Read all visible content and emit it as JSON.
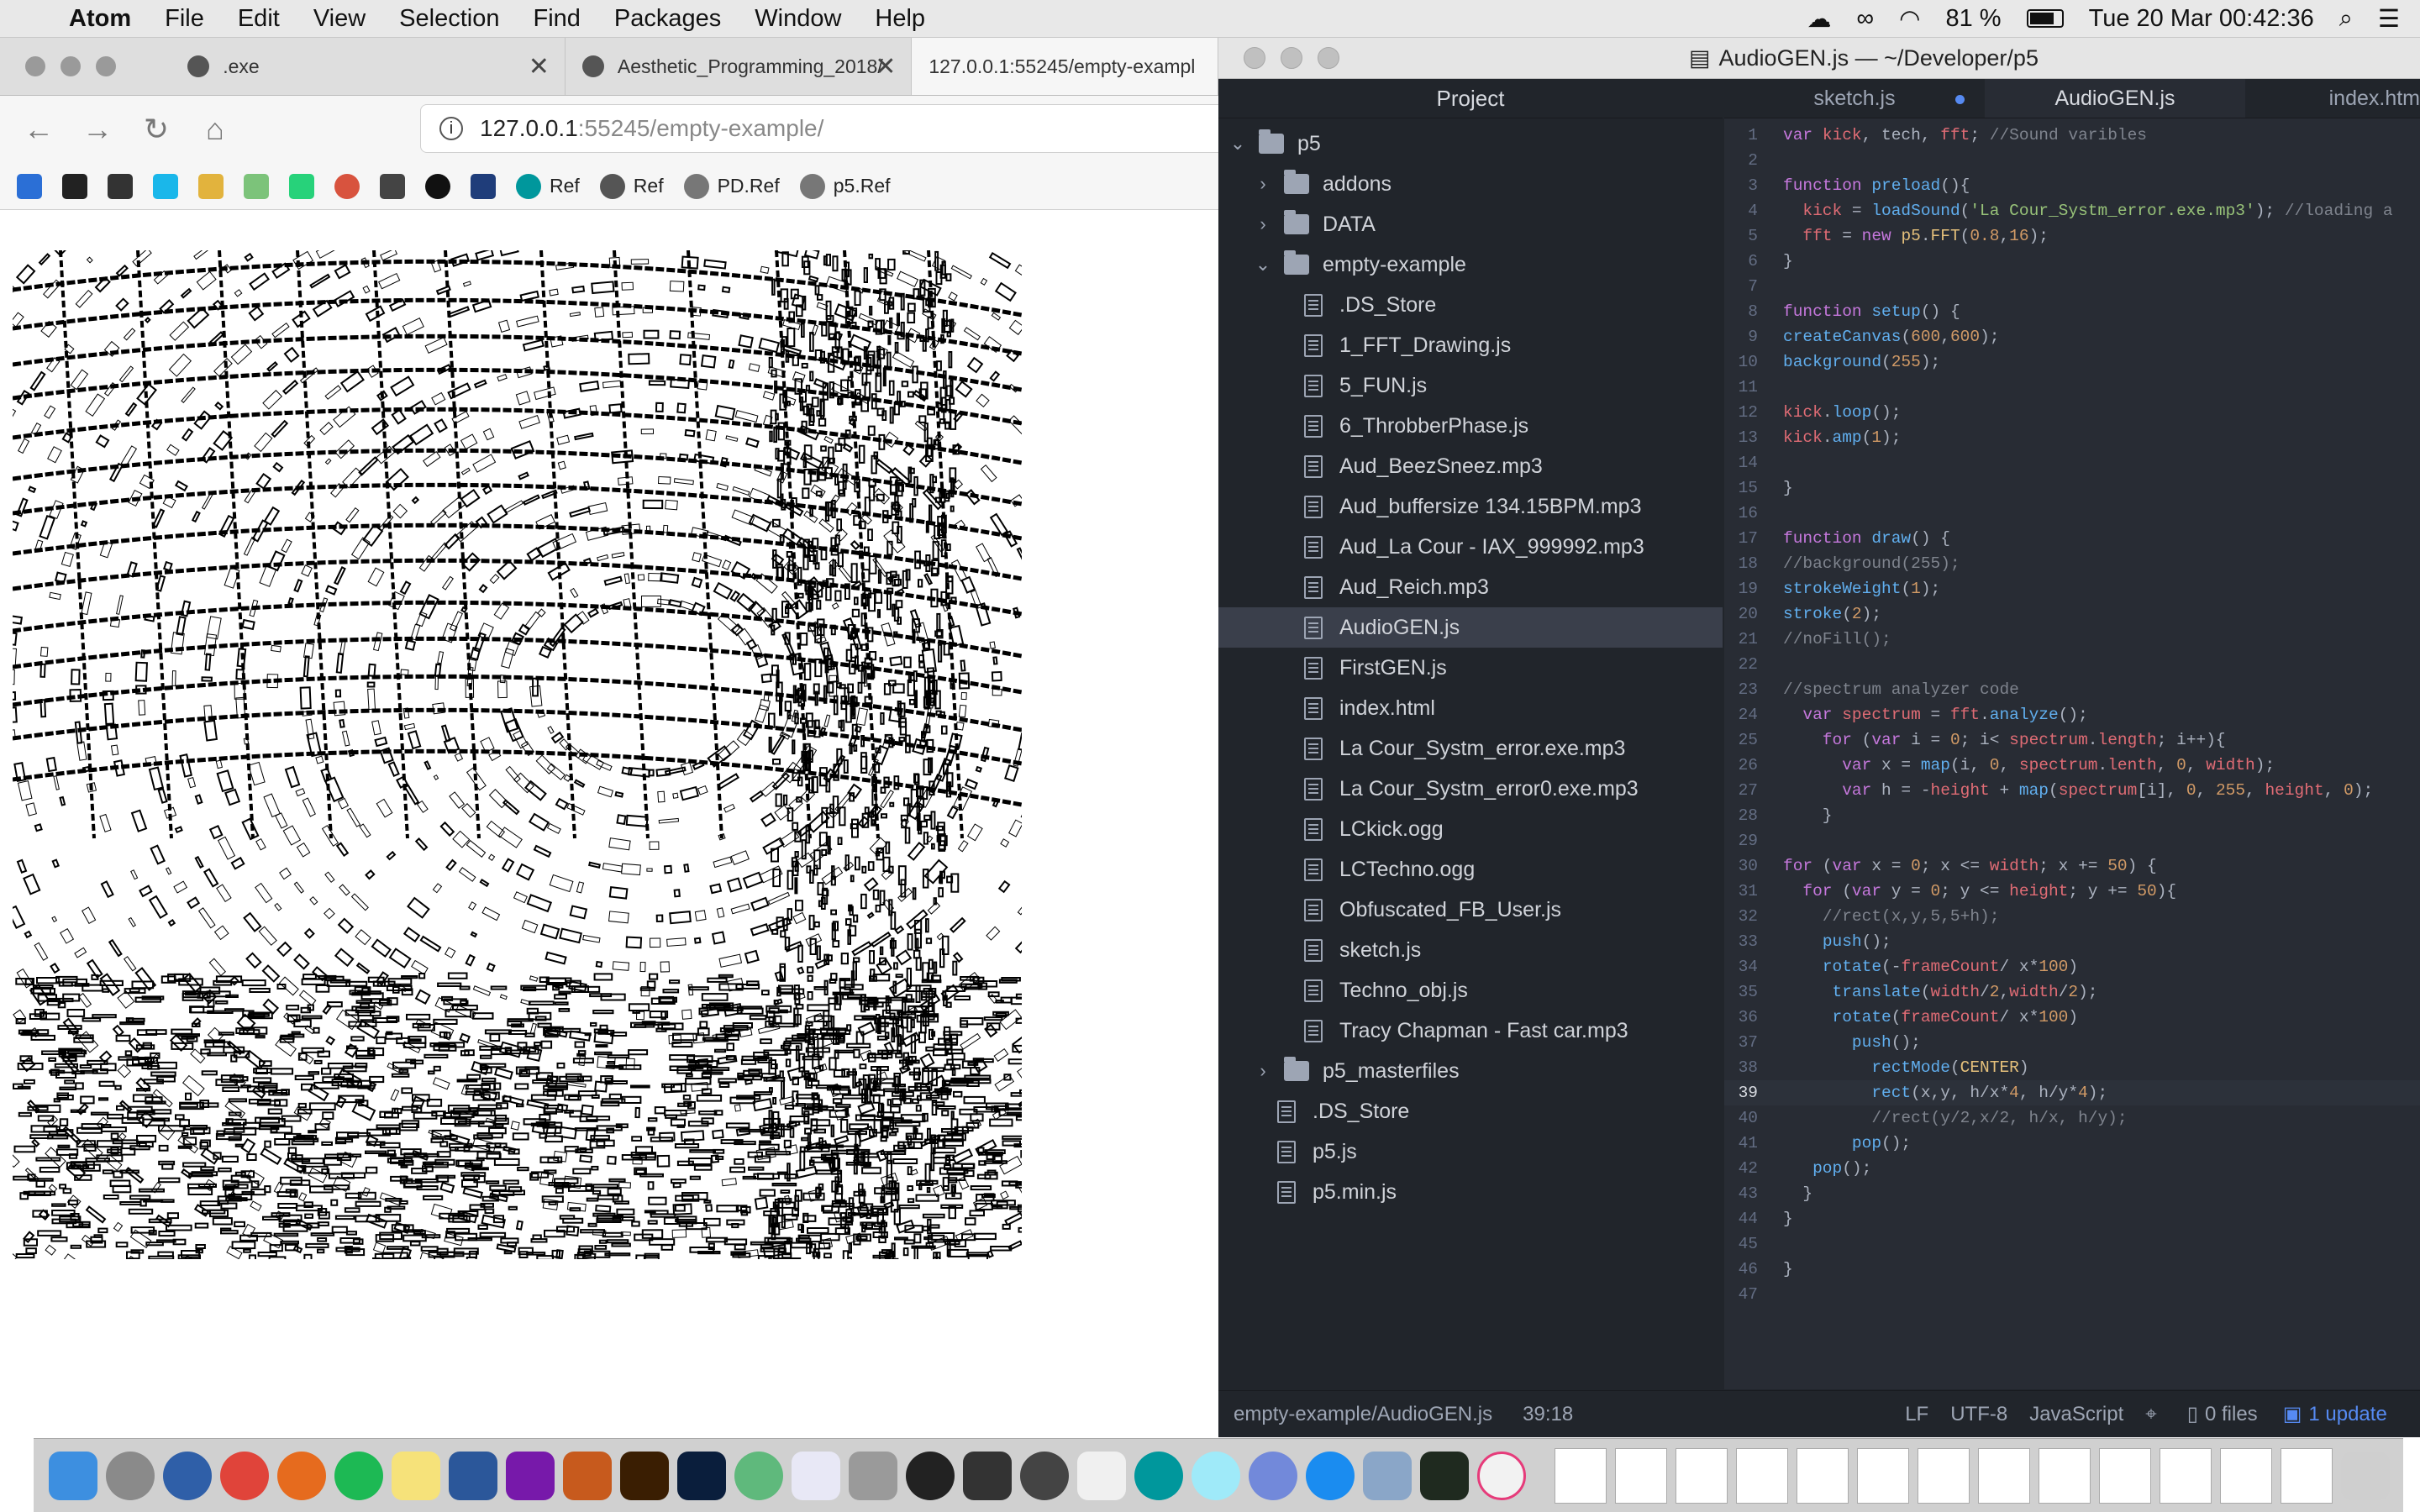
{
  "menubar": {
    "app_name": "Atom",
    "items": [
      "File",
      "Edit",
      "View",
      "Selection",
      "Find",
      "Packages",
      "Window",
      "Help"
    ],
    "battery": "81 %",
    "clock": "Tue 20 Mar  00:42:36"
  },
  "browser": {
    "tabs": [
      {
        "title": ".exe"
      },
      {
        "title": "Aesthetic_Programming_2018/"
      },
      {
        "title": "127.0.0.1:55245/empty-exampl"
      }
    ],
    "url_host": "127.0.0.1",
    "url_port_path": ":55245/empty-example/",
    "bookmarks": [
      "Ref",
      "Ref",
      "PD.Ref",
      "p5.Ref"
    ]
  },
  "atom": {
    "window_title": "AudioGEN.js — ~/Developer/p5",
    "project_header": "Project",
    "tabs": [
      "sketch.js",
      "AudioGEN.js",
      "index.htm"
    ],
    "tree": [
      {
        "label": "p5",
        "type": "folder",
        "depth": 0,
        "open": true
      },
      {
        "label": "addons",
        "type": "folder",
        "depth": 1,
        "open": false
      },
      {
        "label": "DATA",
        "type": "folder",
        "depth": 1,
        "open": false
      },
      {
        "label": "empty-example",
        "type": "folder",
        "depth": 1,
        "open": true
      },
      {
        "label": ".DS_Store",
        "type": "file",
        "depth": 2
      },
      {
        "label": "1_FFT_Drawing.js",
        "type": "file",
        "depth": 2
      },
      {
        "label": "5_FUN.js",
        "type": "file",
        "depth": 2
      },
      {
        "label": "6_ThrobberPhase.js",
        "type": "file",
        "depth": 2
      },
      {
        "label": "Aud_BeezSneez.mp3",
        "type": "file",
        "depth": 2
      },
      {
        "label": "Aud_buffersize 134.15BPM.mp3",
        "type": "file",
        "depth": 2
      },
      {
        "label": "Aud_La Cour - IAX_999992.mp3",
        "type": "file",
        "depth": 2
      },
      {
        "label": "Aud_Reich.mp3",
        "type": "file",
        "depth": 2
      },
      {
        "label": "AudioGEN.js",
        "type": "file",
        "depth": 2,
        "selected": true
      },
      {
        "label": "FirstGEN.js",
        "type": "file",
        "depth": 2
      },
      {
        "label": "index.html",
        "type": "file",
        "depth": 2
      },
      {
        "label": "La Cour_Systm_error.exe.mp3",
        "type": "file",
        "depth": 2
      },
      {
        "label": "La Cour_Systm_error0.exe.mp3",
        "type": "file",
        "depth": 2
      },
      {
        "label": "LCkick.ogg",
        "type": "file",
        "depth": 2
      },
      {
        "label": "LCTechno.ogg",
        "type": "file",
        "depth": 2
      },
      {
        "label": "Obfuscated_FB_User.js",
        "type": "file",
        "depth": 2
      },
      {
        "label": "sketch.js",
        "type": "file",
        "depth": 2
      },
      {
        "label": "Techno_obj.js",
        "type": "file",
        "depth": 2
      },
      {
        "label": "Tracy Chapman - Fast car.mp3",
        "type": "file",
        "depth": 2
      },
      {
        "label": "p5_masterfiles",
        "type": "folder",
        "depth": 1,
        "open": false
      },
      {
        "label": ".DS_Store",
        "type": "file",
        "depth": 1
      },
      {
        "label": "p5.js",
        "type": "file",
        "depth": 1
      },
      {
        "label": "p5.min.js",
        "type": "file",
        "depth": 1
      }
    ],
    "code": [
      "var kick, tech, fft; //Sound varibles",
      "",
      "function preload(){",
      "  kick = loadSound('La Cour_Systm_error.exe.mp3'); //loading a",
      "  fft = new p5.FFT(0.8,16);",
      "}",
      "",
      "function setup() {",
      "createCanvas(600,600);",
      "background(255);",
      "",
      "kick.loop();",
      "kick.amp(1);",
      "",
      "}",
      "",
      "function draw() {",
      "//background(255);",
      "strokeWeight(1);",
      "stroke(2);",
      "//noFill();",
      "",
      "//spectrum analyzer code",
      "  var spectrum = fft.analyze();",
      "    for (var i = 0; i< spectrum.length; i++){",
      "      var x = map(i, 0, spectrum.lenth, 0, width);",
      "      var h = -height + map(spectrum[i], 0, 255, height, 0);",
      "    }",
      "",
      "for (var x = 0; x <= width; x += 50) {",
      "  for (var y = 0; y <= height; y += 50){",
      "    //rect(x,y,5,5+h);",
      "    push();",
      "    rotate(-frameCount/ x*100)",
      "     translate(width/2,width/2);",
      "     rotate(frameCount/ x*100)",
      "       push();",
      "         rectMode(CENTER)",
      "         rect(x,y, h/x*4, h/y*4);",
      "         //rect(y/2,x/2, h/x, h/y);",
      "       pop();",
      "   pop();",
      "  }",
      "}",
      "",
      "}",
      ""
    ],
    "current_line": 39,
    "status": {
      "path": "empty-example/AudioGEN.js",
      "cursor": "39:18",
      "eol": "LF",
      "encoding": "UTF-8",
      "grammar": "JavaScript",
      "files": "0 files",
      "updates": "1 update"
    }
  }
}
